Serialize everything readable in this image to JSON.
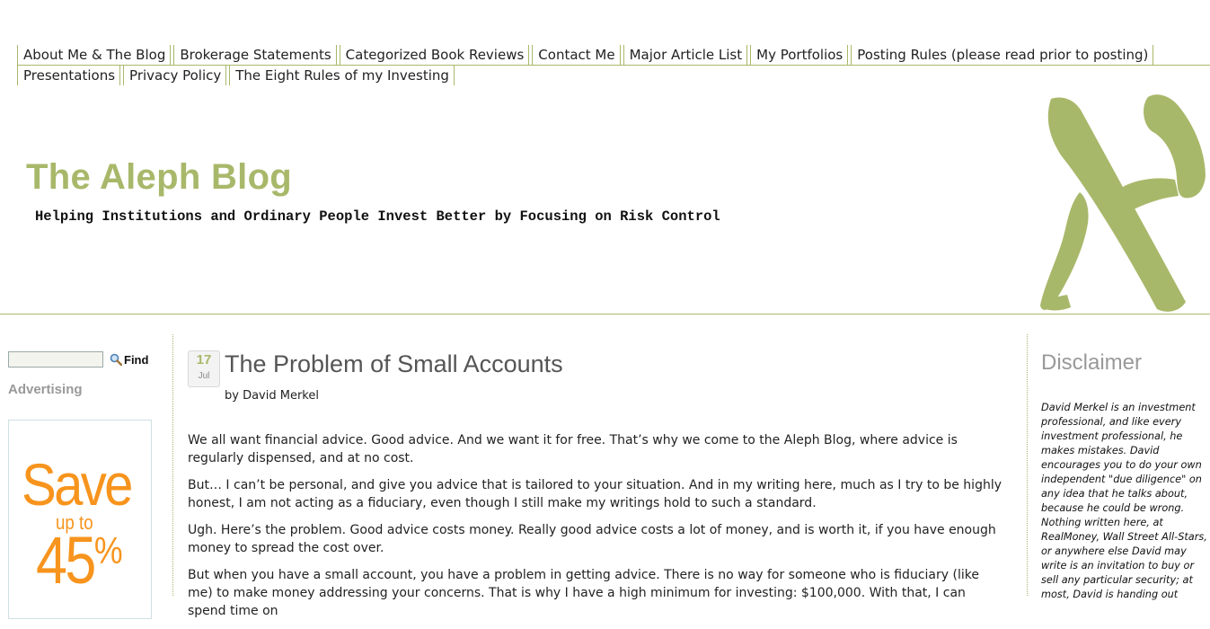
{
  "nav": {
    "row1": [
      "About Me & The Blog",
      "Brokerage Statements",
      "Categorized Book Reviews",
      "Contact Me",
      "Major Article List",
      "My Portfolios",
      "Posting Rules (please read prior to posting)"
    ],
    "row2": [
      "Presentations",
      "Privacy Policy",
      "The Eight Rules of my Investing"
    ]
  },
  "header": {
    "title": "The Aleph Blog",
    "tagline": "Helping Institutions and Ordinary People Invest Better by Focusing on Risk Control",
    "logo_icon": "aleph-letter-logo",
    "accent_color": "#a8b86a"
  },
  "sidebar": {
    "search_value": "",
    "find_label": "Find",
    "find_icon": "magnifier-icon",
    "advertising_label": "Advertising",
    "ad": {
      "save": "Save",
      "up_to": "up to",
      "number": "45",
      "percent": "%",
      "color": "#f7941d"
    }
  },
  "post": {
    "day": "17",
    "month": "Jul",
    "title": "The Problem of Small Accounts",
    "byline": "by David Merkel",
    "paragraphs": [
      "We all want financial advice.  Good advice.  And we want it for free.  That’s why we come to the Aleph Blog, where advice is regularly dispensed, and at no cost.",
      "But… I can’t be personal, and give you advice that is tailored to your situation.  And in my writing here, much as I try to be highly honest, I am not acting as a fiduciary, even though I still make my writings hold to such a standard.",
      "Ugh.  Here’s the problem.  Good advice costs money.  Really good advice costs a lot of money, and is worth it, if you have enough money to spread the cost over.",
      "But when you have a small account, you have a problem in getting advice.  There is no way for someone who is fiduciary (like me) to make money addressing your concerns.  That is why I have a high minimum for investing: $100,000.  With that, I can spend time on"
    ]
  },
  "disclaimer": {
    "title": "Disclaimer",
    "text": "David Merkel is an investment professional, and like every investment professional, he makes mistakes. David encourages you to do your own independent \"due diligence\" on any idea that he talks about, because he could be wrong. Nothing written here, at RealMoney, Wall Street All-Stars, or anywhere else David may write is an invitation to buy or sell any particular security; at most, David is handing out"
  }
}
